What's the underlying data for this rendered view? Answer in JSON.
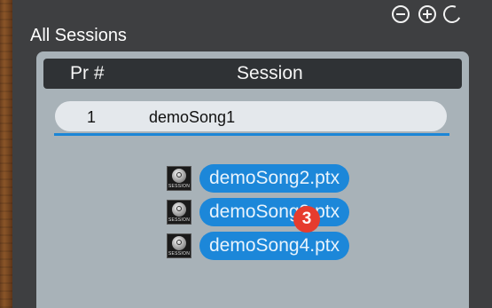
{
  "window": {
    "title": "All Sessions"
  },
  "toolbar": {
    "remove_icon": "minus-circle-icon",
    "add_icon": "plus-circle-icon",
    "refresh_icon": "rotate-circle-icon"
  },
  "table": {
    "columns": [
      "Pr #",
      "Session"
    ],
    "rows": [
      {
        "number": "1",
        "session": "demoSong1",
        "selected": true
      }
    ]
  },
  "dragged_items": [
    {
      "label": "demoSong2.ptx",
      "icon": "session-file-icon",
      "icon_caption": "SESSION"
    },
    {
      "label": "demoSong3.ptx",
      "icon": "session-file-icon",
      "icon_caption": "SESSION"
    },
    {
      "label": "demoSong4.ptx",
      "icon": "session-file-icon",
      "icon_caption": "SESSION"
    }
  ],
  "drag_count_badge": "3",
  "colors": {
    "accent": "#1c87d9",
    "badge": "#e63c2e",
    "panel": "#3e3f41",
    "list_bg": "#a8b2b8"
  }
}
